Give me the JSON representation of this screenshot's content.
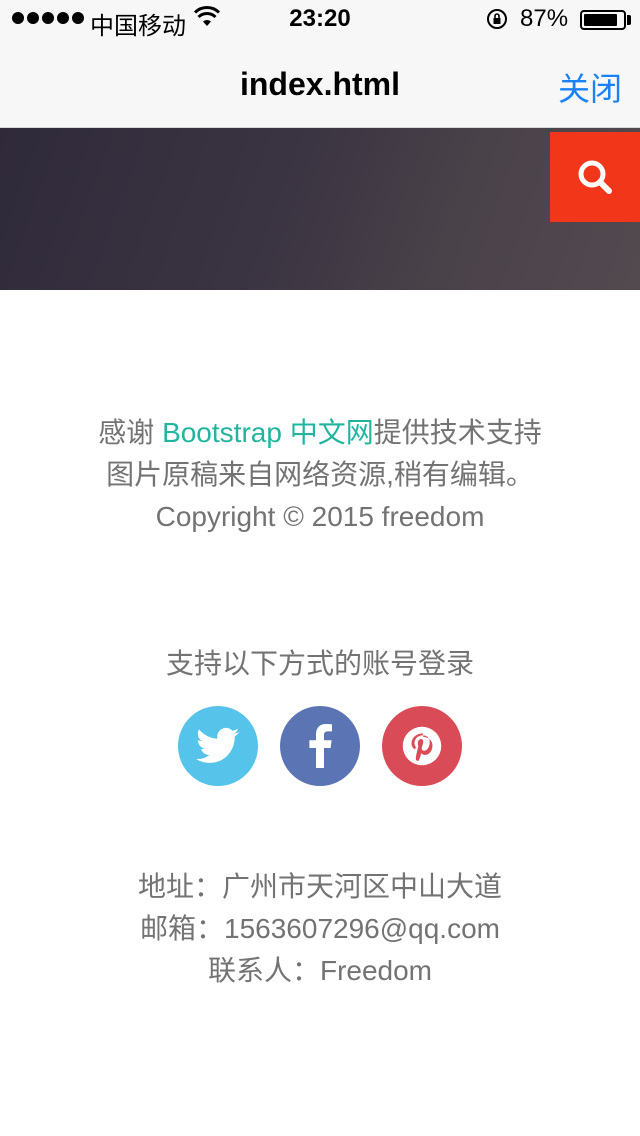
{
  "status_bar": {
    "carrier": "中国移动",
    "time": "23:20",
    "battery_percent": "87%",
    "battery_level": 0.87
  },
  "nav": {
    "title": "index.html",
    "close_label": "关闭"
  },
  "banner": {
    "gradient_colors": [
      "#2f2a3a",
      "#524a4f"
    ],
    "search_color": "#f1361a",
    "search_icon": "search-icon"
  },
  "credits": {
    "thanks_prefix": "感谢 ",
    "thanks_link": "Bootstrap 中文网",
    "thanks_suffix": "提供技术支持",
    "source_note": "图片原稿来自网络资源,稍有编辑。",
    "copyright": "Copyright © 2015 freedom"
  },
  "login": {
    "title": "支持以下方式的账号登录",
    "providers": [
      {
        "name": "twitter",
        "icon": "twitter-icon",
        "color": "#55c3ea"
      },
      {
        "name": "facebook",
        "icon": "facebook-icon",
        "color": "#5b75b4"
      },
      {
        "name": "pinterest",
        "icon": "pinterest-icon",
        "color": "#d94c57"
      }
    ]
  },
  "contact": {
    "address": "地址：广州市天河区中山大道",
    "email": "邮箱：1563607296@qq.com",
    "person": "联系人：Freedom"
  },
  "colors": {
    "accent_teal": "#21b5a0",
    "ios_blue": "#1a82f7",
    "text_gray": "#737373"
  }
}
